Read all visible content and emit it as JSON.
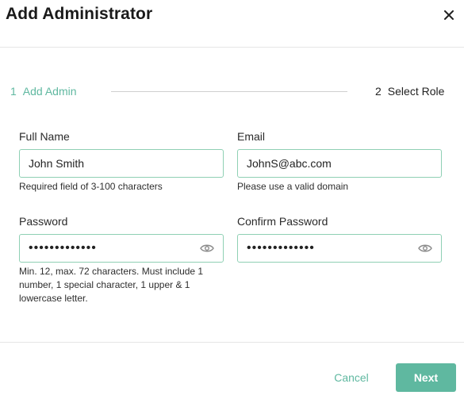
{
  "dialog": {
    "title": "Add Administrator",
    "close_icon": "close-icon"
  },
  "steps": [
    {
      "number": "1",
      "label": "Add Admin",
      "state": "active"
    },
    {
      "number": "2",
      "label": "Select Role",
      "state": "inactive"
    }
  ],
  "form": {
    "full_name": {
      "label": "Full Name",
      "value": "John Smith",
      "hint": "Required field of 3-100 characters"
    },
    "email": {
      "label": "Email",
      "value": "JohnS@abc.com",
      "hint": "Please use a valid domain"
    },
    "password": {
      "label": "Password",
      "value": "•••••••••••••",
      "hint": "Min. 12, max. 72 characters. Must include 1 number, 1 special character, 1 upper & 1 lowercase letter.",
      "icon": "eye-icon"
    },
    "confirm_password": {
      "label": "Confirm Password",
      "value": "•••••••••••••",
      "icon": "eye-icon"
    }
  },
  "footer": {
    "cancel_label": "Cancel",
    "next_label": "Next"
  },
  "colors": {
    "accent": "#5fb8a0",
    "input_border": "#8fd0b4",
    "divider": "#e6e6e6"
  }
}
